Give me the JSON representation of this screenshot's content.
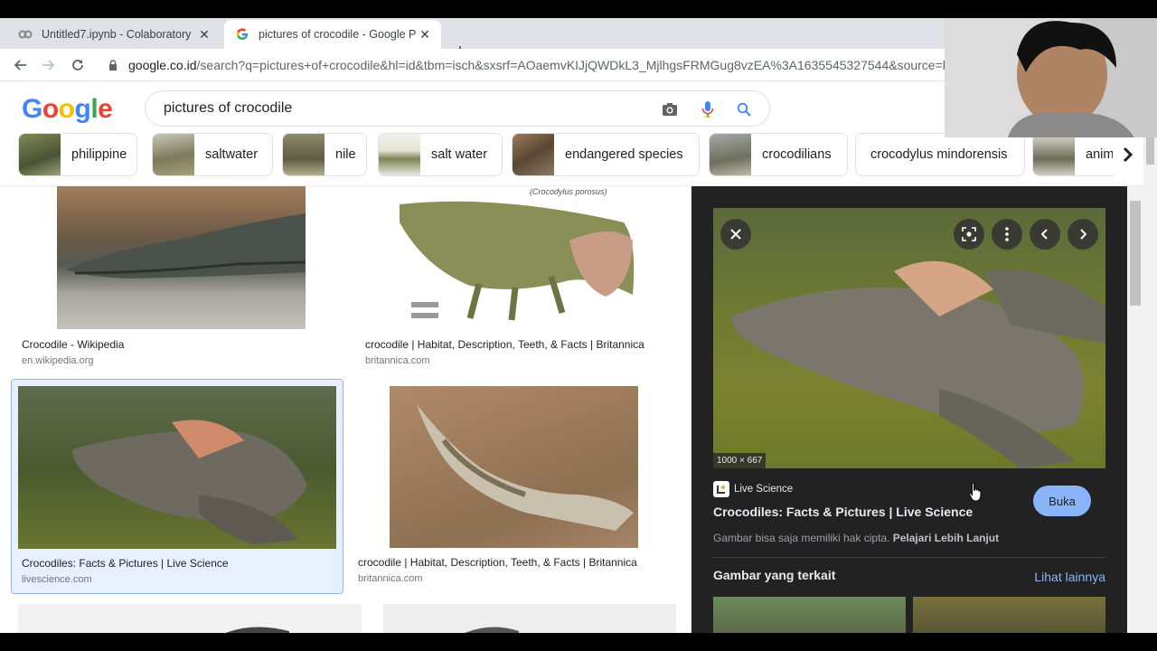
{
  "browser": {
    "tabs": [
      {
        "title": "Untitled7.ipynb - Colaboratory",
        "favicon": "colab-icon",
        "active": false
      },
      {
        "title": "pictures of crocodile - Google Pe",
        "favicon": "google-g-icon",
        "active": true
      }
    ],
    "url_host": "google.co.id",
    "url_rest": "/search?q=pictures+of+crocodile&hl=id&tbm=isch&sxsrf=AOaemvKIJjQWDkL3_MjlhgsFRMGug8vzEA%3A1635545327544&source=h"
  },
  "google": {
    "logo": "Google",
    "query": "pictures of crocodile",
    "chips": [
      "philippine",
      "saltwater",
      "nile",
      "salt water",
      "endangered species",
      "crocodilians",
      "crocodylus mindorensis",
      "anim"
    ]
  },
  "results": [
    {
      "caption": "Crocodile - Wikipedia",
      "source": "en.wikipedia.org"
    },
    {
      "caption": "crocodile | Habitat, Description, Teeth, & Facts | Britannica",
      "source": "britannica.com",
      "overlay": "(Crocodylus porosus)"
    },
    {
      "caption": "Crocodiles: Facts & Pictures | Live Science",
      "source": "livescience.com"
    },
    {
      "caption": "crocodile | Habitat, Description, Teeth, & Facts | Britannica",
      "source": "britannica.com"
    }
  ],
  "panel": {
    "dimensions": "1000 × 667",
    "site": "Live Science",
    "title": "Crocodiles: Facts & Pictures | Live Science",
    "open_label": "Buka",
    "copyright_text": "Gambar bisa saja memiliki hak cipta.",
    "learn_more": "Pelajari Lebih Lanjut",
    "related_heading": "Gambar yang terkait",
    "see_more": "Lihat lainnya"
  },
  "colors": {
    "google_blue": "#4285f4",
    "google_red": "#ea4335",
    "google_yellow": "#fbbc05",
    "google_green": "#34a853",
    "panel_bg": "#222222",
    "accent": "#8ab4f8"
  }
}
